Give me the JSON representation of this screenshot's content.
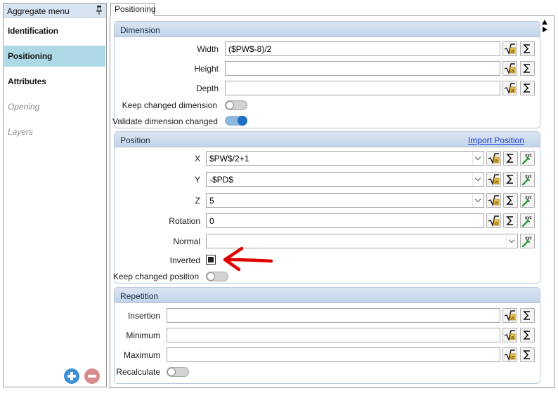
{
  "left_pane": {
    "title": "Aggregate menu",
    "items": [
      {
        "label": "Identification",
        "state": "normal"
      },
      {
        "label": "Positioning",
        "state": "active"
      },
      {
        "label": "Attributes",
        "state": "normal"
      },
      {
        "label": "Opening",
        "state": "disabled"
      },
      {
        "label": "Layers",
        "state": "disabled"
      }
    ]
  },
  "tab": {
    "label": "Positioning"
  },
  "dimension": {
    "title": "Dimension",
    "width_label": "Width",
    "width_value": "($PW$-8)/2",
    "height_label": "Height",
    "height_value": "",
    "depth_label": "Depth",
    "depth_value": "",
    "keep_changed_label": "Keep changed dimension",
    "keep_changed_on": false,
    "validate_label": "Validate dimension changed",
    "validate_on": true
  },
  "position": {
    "title": "Position",
    "import_link": "Import Position",
    "x_label": "X",
    "x_value": "$PW$/2+1",
    "y_label": "Y",
    "y_value": "-$PD$",
    "z_label": "Z",
    "z_value": "5",
    "rotation_label": "Rotation",
    "rotation_value": "0",
    "normal_label": "Normal",
    "normal_value": "",
    "inverted_label": "Inverted",
    "inverted_checked": true,
    "keep_changed_label": "Keep changed position",
    "keep_changed_on": false
  },
  "repetition": {
    "title": "Repetition",
    "insertion_label": "Insertion",
    "insertion_value": "",
    "minimum_label": "Minimum",
    "minimum_value": "",
    "maximum_label": "Maximum",
    "maximum_value": "",
    "recalculate_label": "Recalculate",
    "recalculate_on": false
  },
  "icons": {
    "formula": "sqrt-formula-icon",
    "sum": "sigma-sum-icon",
    "pick": "xyz-pick-icon",
    "pin": "pin-icon",
    "add": "plus-icon",
    "remove": "minus-icon"
  },
  "colors": {
    "accent": "#1e6fc0",
    "active_nav": "#add8e6",
    "annotation": "#e00000"
  }
}
